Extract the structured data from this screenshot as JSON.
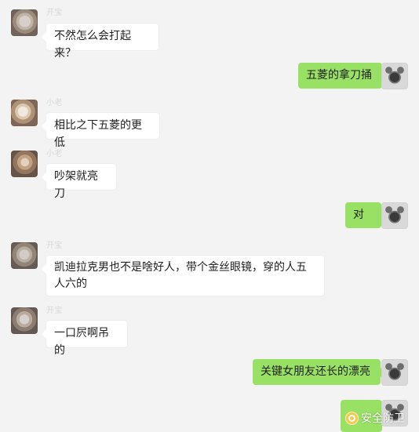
{
  "messages": [
    {
      "side": "left",
      "sender_name": "开宝",
      "text": "不然怎么会打起来？"
    },
    {
      "side": "right",
      "text": "五菱的拿刀捅"
    },
    {
      "side": "left",
      "sender_name": "小老",
      "text": "相比之下五菱的更低"
    },
    {
      "side": "left",
      "sender_name": "小老",
      "text": "吵架就亮刀"
    },
    {
      "side": "right",
      "text": "对"
    },
    {
      "side": "left",
      "sender_name": "开宝",
      "text": "凯迪拉克男也不是啥好人，带个金丝眼镜，穿的人五人六的"
    },
    {
      "side": "left",
      "sender_name": "开宝",
      "text": "一口屄啊吊的"
    },
    {
      "side": "right",
      "text": "关键女朋友还长的漂亮"
    }
  ],
  "watermark": {
    "text": "安全防卫",
    "icon": "shield-logo-icon"
  },
  "colors": {
    "background": "#f3f3f3",
    "incoming_bubble": "#ffffff",
    "outgoing_bubble": "#98e165"
  }
}
